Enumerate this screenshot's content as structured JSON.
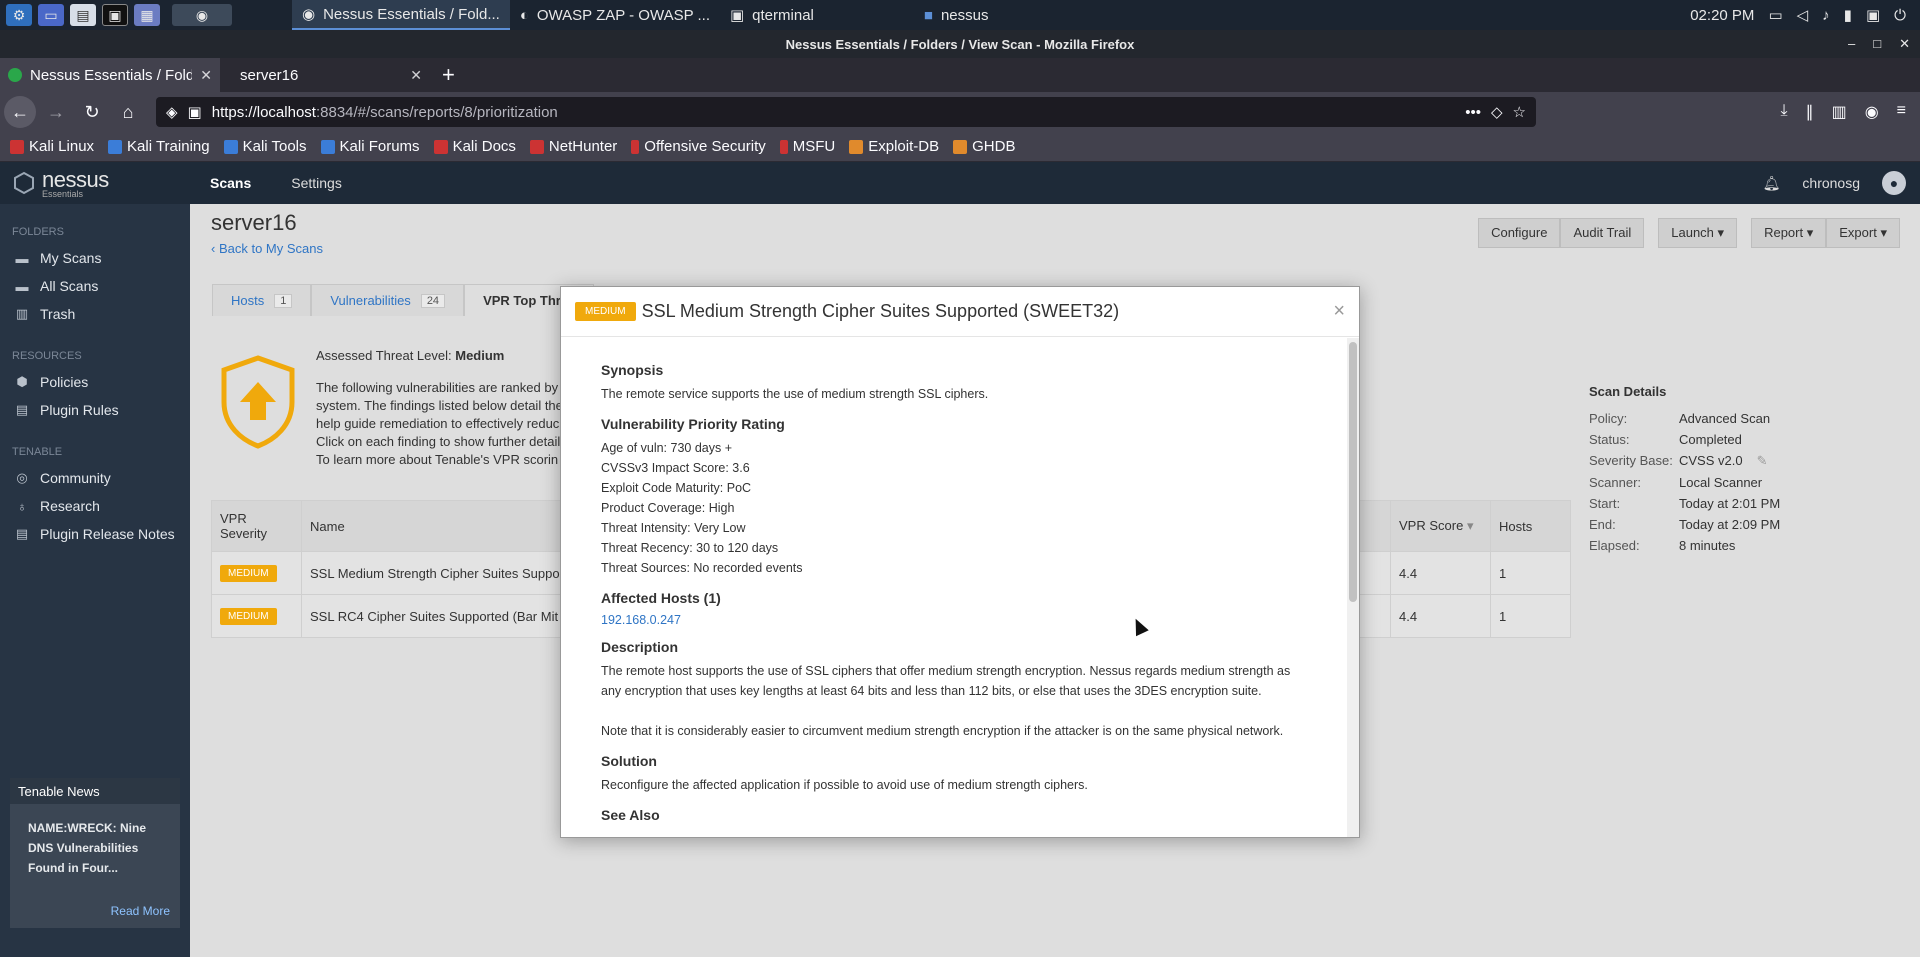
{
  "taskbar": {
    "tasks": [
      {
        "label": "Nessus Essentials / Fold..."
      },
      {
        "label": "OWASP ZAP - OWASP ..."
      },
      {
        "label": "qterminal"
      },
      {
        "label": "nessus"
      }
    ],
    "clock": "02:20 PM"
  },
  "window": {
    "title": "Nessus Essentials / Folders / View Scan - Mozilla Firefox"
  },
  "tabs": [
    {
      "label": "Nessus Essentials / Folde"
    },
    {
      "label": "server16"
    }
  ],
  "url": {
    "host": "https://localhost",
    "rest": ":8834/#/scans/reports/8/prioritization"
  },
  "bookmarks": [
    "Kali Linux",
    "Kali Training",
    "Kali Tools",
    "Kali Forums",
    "Kali Docs",
    "NetHunter",
    "Offensive Security",
    "MSFU",
    "Exploit-DB",
    "GHDB"
  ],
  "nessus": {
    "logo": "nessus",
    "logo_sub": "Essentials",
    "nav": [
      "Scans",
      "Settings"
    ],
    "user": "chronosg"
  },
  "sidebar": {
    "folders_heading": "FOLDERS",
    "folders": [
      "My Scans",
      "All Scans",
      "Trash"
    ],
    "resources_heading": "RESOURCES",
    "resources": [
      "Policies",
      "Plugin Rules"
    ],
    "tenable_heading": "TENABLE",
    "tenable": [
      "Community",
      "Research",
      "Plugin Release Notes"
    ],
    "news": {
      "title": "Tenable News",
      "headline": "NAME:WRECK: Nine DNS Vulnerabilities Found in Four...",
      "more": "Read More"
    }
  },
  "scan": {
    "title": "server16",
    "back": "Back to My Scans",
    "actions": [
      "Configure",
      "Audit Trail",
      "Launch",
      "Report",
      "Export"
    ],
    "tabs": [
      {
        "label": "Hosts",
        "count": "1"
      },
      {
        "label": "Vulnerabilities",
        "count": "24"
      },
      {
        "label": "VPR Top Threa"
      }
    ],
    "threat_level_label": "Assessed Threat Level:",
    "threat_level": "Medium",
    "intro": [
      "The following vulnerabilities are ranked by",
      "system. The findings listed below detail the",
      "help guide remediation to effectively reduc",
      "Click on each finding to show further detail",
      "To learn more about Tenable's VPR scorin"
    ],
    "table": {
      "headers": [
        "VPR Severity",
        "Name",
        "VPR Score",
        "Hosts"
      ],
      "rows": [
        {
          "severity": "MEDIUM",
          "name": "SSL Medium Strength Cipher Suites Suppo",
          "score": "4.4",
          "hosts": "1"
        },
        {
          "severity": "MEDIUM",
          "name": "SSL RC4 Cipher Suites Supported (Bar Mit",
          "score": "4.4",
          "hosts": "1"
        }
      ]
    },
    "details": {
      "heading": "Scan Details",
      "rows": [
        {
          "k": "Policy:",
          "v": "Advanced Scan"
        },
        {
          "k": "Status:",
          "v": "Completed"
        },
        {
          "k": "Severity Base:",
          "v": "CVSS v2.0"
        },
        {
          "k": "Scanner:",
          "v": "Local Scanner"
        },
        {
          "k": "Start:",
          "v": "Today at 2:01 PM"
        },
        {
          "k": "End:",
          "v": "Today at 2:09 PM"
        },
        {
          "k": "Elapsed:",
          "v": "8 minutes"
        }
      ]
    }
  },
  "modal": {
    "badge": "MEDIUM",
    "title": "SSL Medium Strength Cipher Suites Supported (SWEET32)",
    "synopsis_h": "Synopsis",
    "synopsis": "The remote service supports the use of medium strength SSL ciphers.",
    "vpr_h": "Vulnerability Priority Rating",
    "vpr_lines": [
      "Age of vuln: 730 days +",
      "CVSSv3 Impact Score: 3.6",
      "Exploit Code Maturity: PoC",
      "Product Coverage: High",
      "Threat Intensity: Very Low",
      "Threat Recency: 30 to 120 days",
      "Threat Sources: No recorded events"
    ],
    "hosts_h": "Affected Hosts (1)",
    "host": "192.168.0.247",
    "desc_h": "Description",
    "desc1": "The remote host supports the use of SSL ciphers that offer medium strength encryption. Nessus regards medium strength as any encryption that uses key lengths at least 64 bits and less than 112 bits, or else that uses the 3DES encryption suite.",
    "desc2": "Note that it is considerably easier to circumvent medium strength encryption if the attacker is on the same physical network.",
    "sol_h": "Solution",
    "solution": "Reconfigure the affected application if possible to avoid use of medium strength ciphers.",
    "see_h": "See Also"
  }
}
